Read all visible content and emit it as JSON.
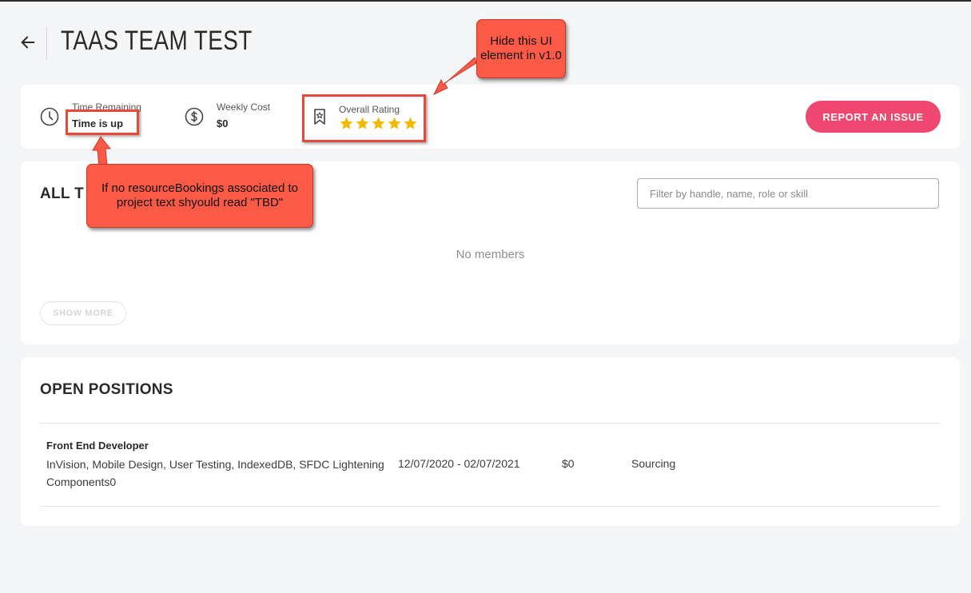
{
  "header": {
    "title": "TAAS TEAM TEST",
    "back_icon": "arrow-left-icon"
  },
  "summary": {
    "time_remaining": {
      "label": "Time Remaining",
      "value": "Time is up",
      "icon": "clock-icon"
    },
    "weekly_cost": {
      "label": "Weekly Cost",
      "value": "$0",
      "icon": "dollar-circle-icon"
    },
    "overall_rating": {
      "label": "Overall Rating",
      "stars": 5,
      "rating": 5,
      "icon": "bookmark-star-icon",
      "star_color": "#f5b700"
    },
    "report_button": "REPORT AN ISSUE",
    "accent_color": "#ef476f"
  },
  "members": {
    "title": "ALL T",
    "filter_placeholder": "Filter by handle, name, role or skill",
    "filter_value": "",
    "empty_text": "No members",
    "show_more": "SHOW MORE"
  },
  "positions": {
    "title": "OPEN POSITIONS",
    "rows": [
      {
        "role": "Front End Developer",
        "skills": "InVision, Mobile Design, User Testing, IndexedDB, SFDC Lightening Components0",
        "dates": "12/07/2020 - 02/07/2021",
        "cost": "$0",
        "status": "Sourcing"
      }
    ]
  },
  "annotations": {
    "callout_rating": "Hide this UI element in v1.0",
    "callout_time": "If no resourceBookings associated to project text shyould read \"TBD\"",
    "color": "#fb5a47"
  }
}
